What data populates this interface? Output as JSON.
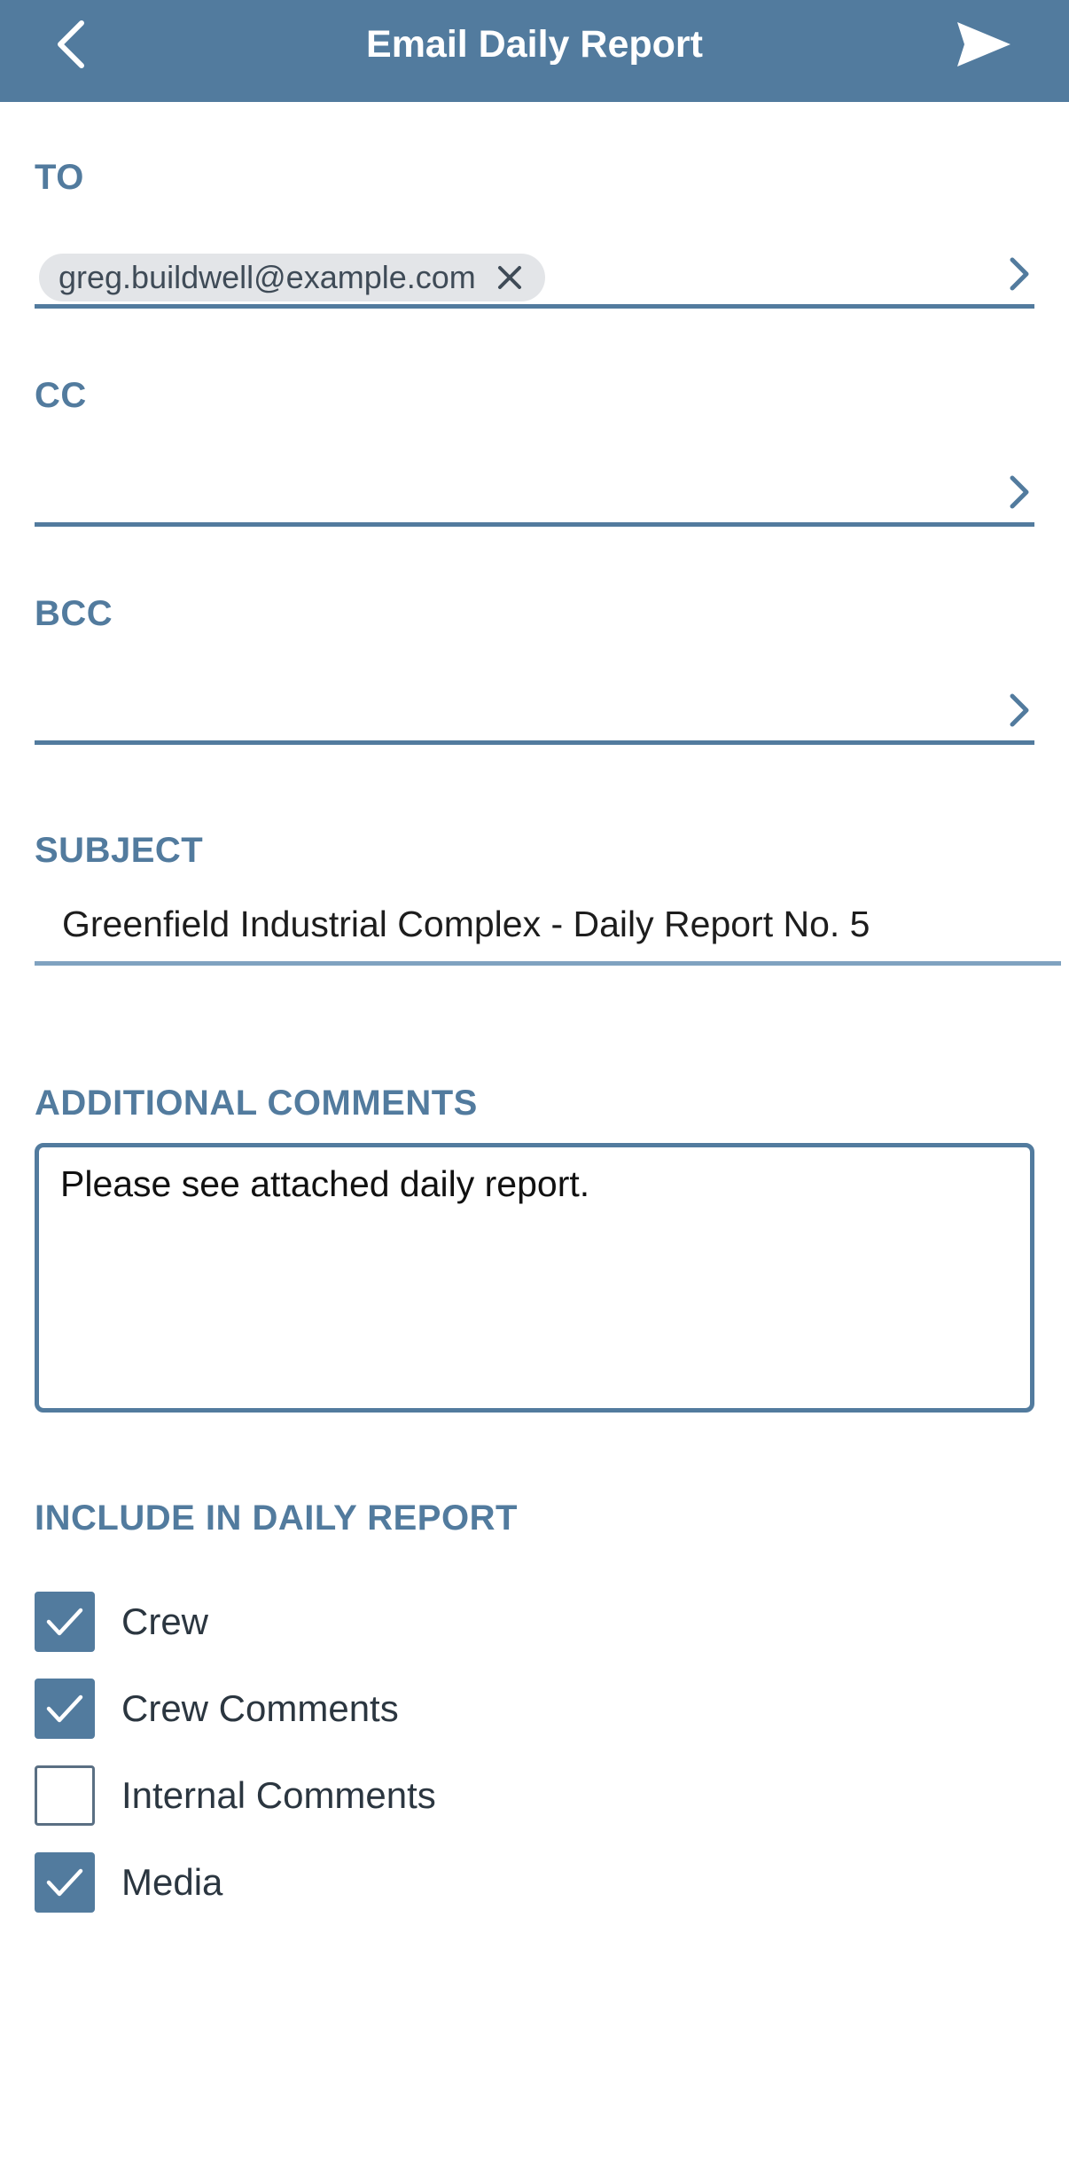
{
  "header": {
    "title": "Email Daily Report",
    "back_icon": "chevron-left-icon",
    "send_icon": "send-icon",
    "background_color": "#527b9e"
  },
  "to": {
    "label": "TO",
    "recipients": [
      "greg.buildwell@example.com"
    ]
  },
  "cc": {
    "label": "CC"
  },
  "bcc": {
    "label": "BCC"
  },
  "subject": {
    "label": "SUBJECT",
    "value": "Greenfield Industrial Complex - Daily Report No. 5"
  },
  "comments": {
    "label": "ADDITIONAL COMMENTS",
    "value": "Please see attached daily report."
  },
  "include": {
    "label": "INCLUDE IN DAILY REPORT",
    "options": [
      {
        "label": "Crew",
        "checked": true
      },
      {
        "label": "Crew Comments",
        "checked": true
      },
      {
        "label": "Internal Comments",
        "checked": false
      },
      {
        "label": "Media",
        "checked": true
      }
    ]
  },
  "colors": {
    "accent": "#527b9e",
    "chip_background": "#e3e5e8"
  }
}
